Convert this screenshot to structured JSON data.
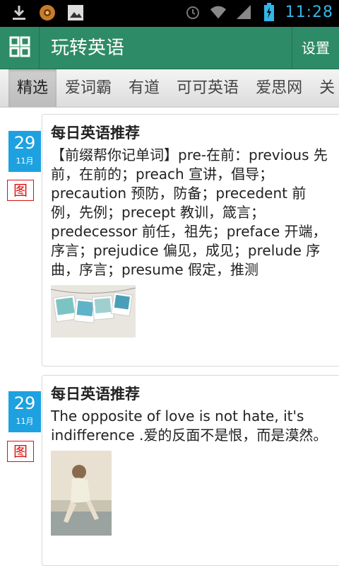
{
  "status_bar": {
    "time": "11:28",
    "left_icons": [
      "download-icon",
      "app-icon",
      "image-icon"
    ],
    "right_icons": [
      "alarm-icon",
      "wifi-icon",
      "signal-icon",
      "battery-icon"
    ]
  },
  "app_bar": {
    "title": "玩转英语",
    "settings_label": "设置",
    "color": "#2e8b67"
  },
  "tabs": [
    {
      "label": "精选",
      "active": true
    },
    {
      "label": "爱词霸",
      "active": false
    },
    {
      "label": "有道",
      "active": false
    },
    {
      "label": "可可英语",
      "active": false
    },
    {
      "label": "爱思网",
      "active": false
    },
    {
      "label": "关",
      "active": false
    }
  ],
  "feed": [
    {
      "day": "29",
      "month": "11月",
      "pic_tag": "图",
      "title": "每日英语推荐",
      "body": "【前缀帮你记单词】pre-在前：previous 先前，在前的；preach 宣讲，倡导；precaution 预防，防备；precedent 前例，先例；precept 教训，箴言；predecessor 前任，祖先；preface 开端，序言；prejudice 偏见，成见；prelude 序曲，序言；presume 假定，推测",
      "image": "polaroid-photos-image"
    },
    {
      "day": "29",
      "month": "11月",
      "pic_tag": "图",
      "title": "每日英语推荐",
      "body": "The opposite of love is not hate, it's indifference .爱的反面不是恨，而是漠然。",
      "image": "girl-by-water-image"
    }
  ],
  "colors": {
    "accent_blue": "#1ea1e0",
    "tag_red": "#dd1111"
  }
}
